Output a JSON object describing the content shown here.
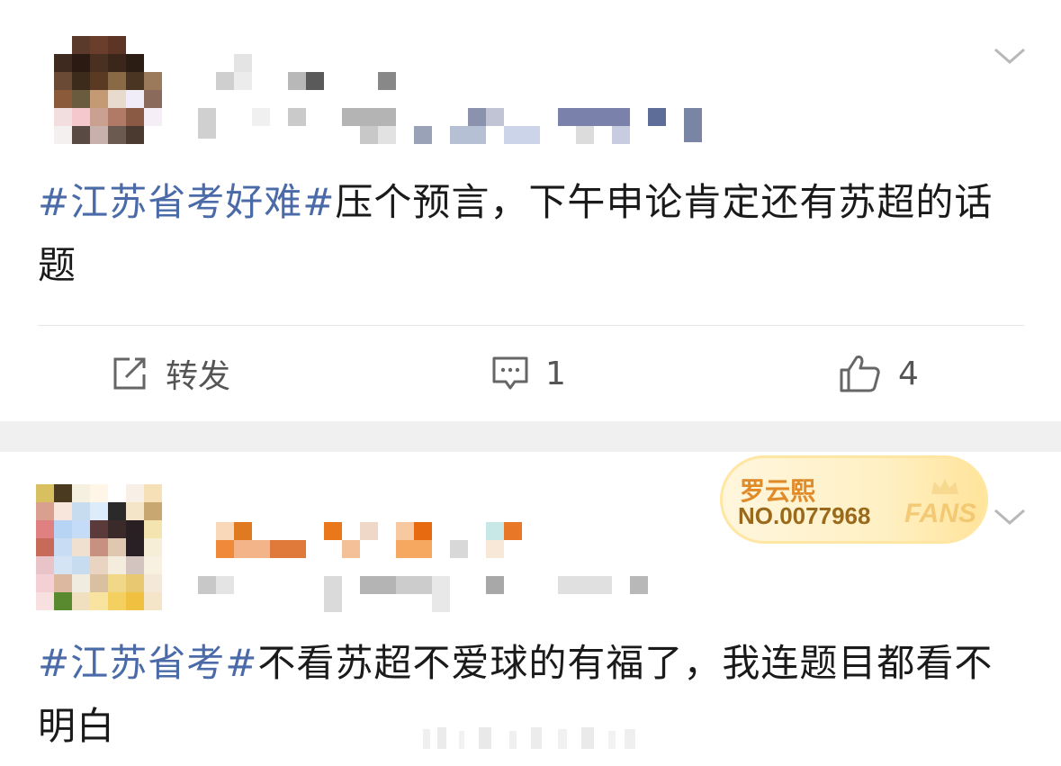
{
  "posts": [
    {
      "text_tag": "#江苏省考好难#",
      "text_body": "压个预言，下午申论肯定还有苏超的话题",
      "actions": {
        "repost_label": "转发",
        "comment_count": "1",
        "like_count": "4"
      }
    },
    {
      "text_tag": "#江苏省考#",
      "text_body": "不看苏超不爱球的有福了，我连题目都看不明白",
      "fans_badge": {
        "name": "罗云熙",
        "number": "NO.0077968",
        "label": "FANS"
      }
    }
  ],
  "colors": {
    "topic_link": "#4a6aa8",
    "text": "#1a1a1a",
    "action_gray": "#555555",
    "badge_orange": "#e08a2a"
  },
  "icons": [
    "repost-icon",
    "comment-icon",
    "like-icon",
    "chevron-down-icon",
    "crown-icon"
  ]
}
